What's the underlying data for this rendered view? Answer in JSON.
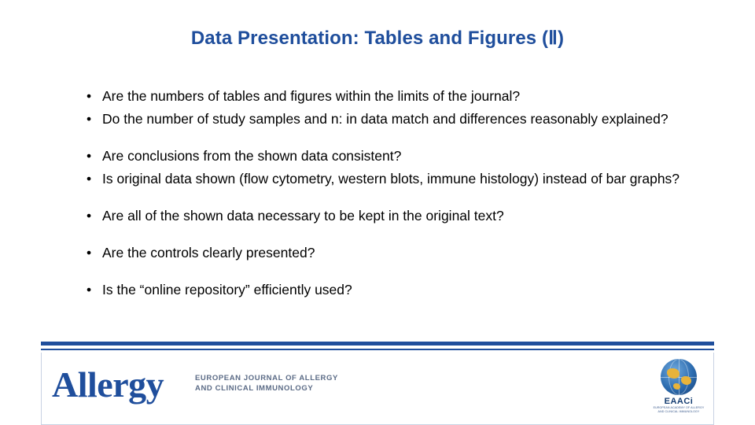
{
  "slide": {
    "title": "Data Presentation: Tables and Figures (Ⅱ)",
    "title_color": "#1F4E9C",
    "bullet_groups": [
      {
        "items": [
          "Are the numbers of tables and figures within the limits of the journal?",
          "Do the number of study samples and n: in data match and differences reasonably explained?"
        ]
      },
      {
        "items": [
          "Are conclusions from the shown data consistent?",
          "Is original data shown (flow cytometry, western blots, immune histology) instead of bar graphs?"
        ]
      },
      {
        "items": [
          "Are all of the shown data necessary to be kept in the original text?"
        ]
      },
      {
        "items": [
          "Are the controls clearly presented?"
        ]
      },
      {
        "items": [
          "Is the “online repository” efficiently used?"
        ]
      }
    ],
    "bullet_marker": "•"
  },
  "footer": {
    "journal_name": "Allergy",
    "journal_subtitle_line1": "EUROPEAN JOURNAL OF ALLERGY",
    "journal_subtitle_line2": "AND CLINICAL IMMUNOLOGY",
    "society_acronym": "EAACi",
    "society_tagline_line1": "EUROPEAN ACADEMY OF ALLERGY",
    "society_tagline_line2": "AND CLINICAL IMMUNOLOGY",
    "accent_color": "#1F4E9C"
  }
}
